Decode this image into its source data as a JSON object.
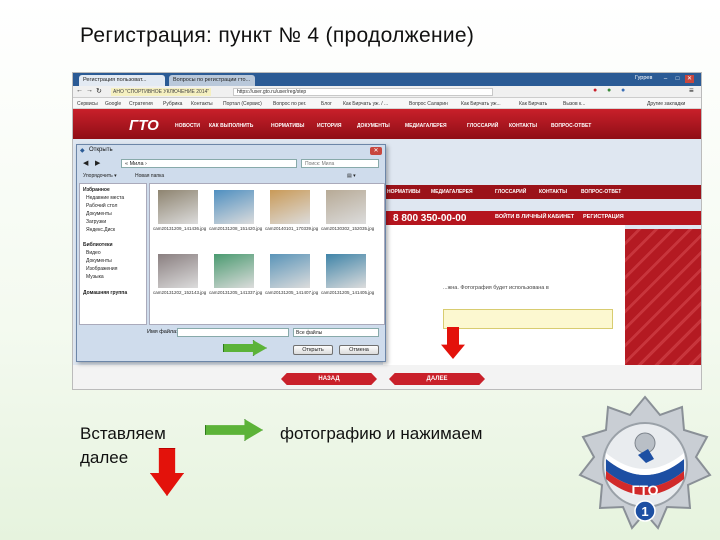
{
  "slide": {
    "title": "Регистрация: пункт № 4 (продолжение)",
    "caption_left": "Вставляем далее",
    "caption_right": "фотографию и нажимаем"
  },
  "browser": {
    "tabs": [
      "Регистрация пользоват...",
      "Вопросы по регистрации гто..."
    ],
    "user_badge": "Гуррев",
    "url": "https://user.gto.ru/user/reg/step",
    "site_tag": "АНО \"СПОРТИВНОЕ УКЛЮЧЕНИЕ 2014\"",
    "bookmarks": [
      "Сервисы",
      "Google",
      "Стратегия",
      "Рубрика",
      "Контакты",
      "Портал (Сервис)",
      "Вопрос по рег.",
      "Блог",
      "Как Бирчать уж. / ...",
      "Вопрос Саларин",
      "Как Бирчать уж...",
      "Как Бирчать",
      "Вызов к...",
      "Другие закладки"
    ]
  },
  "site": {
    "logo": "ГТО",
    "nav": [
      "НОВОСТИ",
      "КАК ВЫПОЛНИТЬ",
      "НОРМАТИВЫ",
      "ИСТОРИЯ",
      "ДОКУМЕНТЫ",
      "МЕДИАГАЛЕРЕЯ",
      "ГЛОССАРИЙ",
      "КОНТАКТЫ",
      "ВОПРОС-ОТВЕТ"
    ],
    "nav_repeat": [
      "НОРМАТИВЫ",
      "МЕДИАГАЛЕРЕЯ",
      "ГЛОССАРИЙ",
      "КОНТАКТЫ",
      "ВОПРОС-ОТВЕТ"
    ],
    "phone": "8 800 350-00-00",
    "login_button": "ВОЙТИ В ЛИЧНЫЙ КАБИНЕТ",
    "register_button": "РЕГИСТРАЦИЯ",
    "partial_text": "...жна. Фотография будет использована в",
    "back_button": "НАЗАД",
    "next_button": "ДАЛЕЕ"
  },
  "dialog": {
    "title": "Открыть",
    "path": "« Мила ›",
    "search_placeholder": "Поиск: Мила",
    "toolbar": [
      "Упорядочить ▾",
      "Новая папка"
    ],
    "tree": [
      "Избранное",
      "Недавние места",
      "Рабочий стол",
      "Документы",
      "Загрузки",
      "Яндекс.Диск",
      "Библиотеки",
      "Видео",
      "Документы",
      "Изображения",
      "Музыка",
      "Домашняя группа"
    ],
    "files": [
      {
        "name": "cam20131209_141436.jpg",
        "color": "#8e8470"
      },
      {
        "name": "cam20131208_151420.jpg",
        "color": "#4f8fc0"
      },
      {
        "name": "cam20140101_170339.jpg",
        "color": "#c99a58"
      },
      {
        "name": "cam20130302_152035.jpg",
        "color": "#b7aa96"
      },
      {
        "name": "cam20131202_152143.jpg",
        "color": "#8a7f80"
      },
      {
        "name": "cam20131205_141337.jpg",
        "color": "#4a9a70"
      },
      {
        "name": "cam20131205_141407.jpg",
        "color": "#5a94b8"
      },
      {
        "name": "cam20131205_141405.jpg",
        "color": "#3f84a8"
      }
    ],
    "filename_label": "Имя файла:",
    "filetype": "Все файлы",
    "open_button": "Открыть",
    "cancel_button": "Отмена"
  },
  "badge": {
    "text": "ГТО",
    "number": "1"
  },
  "colors": {
    "site_red": "#c9202a",
    "arrow_green": "#5cb338",
    "arrow_red": "#e3120b"
  }
}
